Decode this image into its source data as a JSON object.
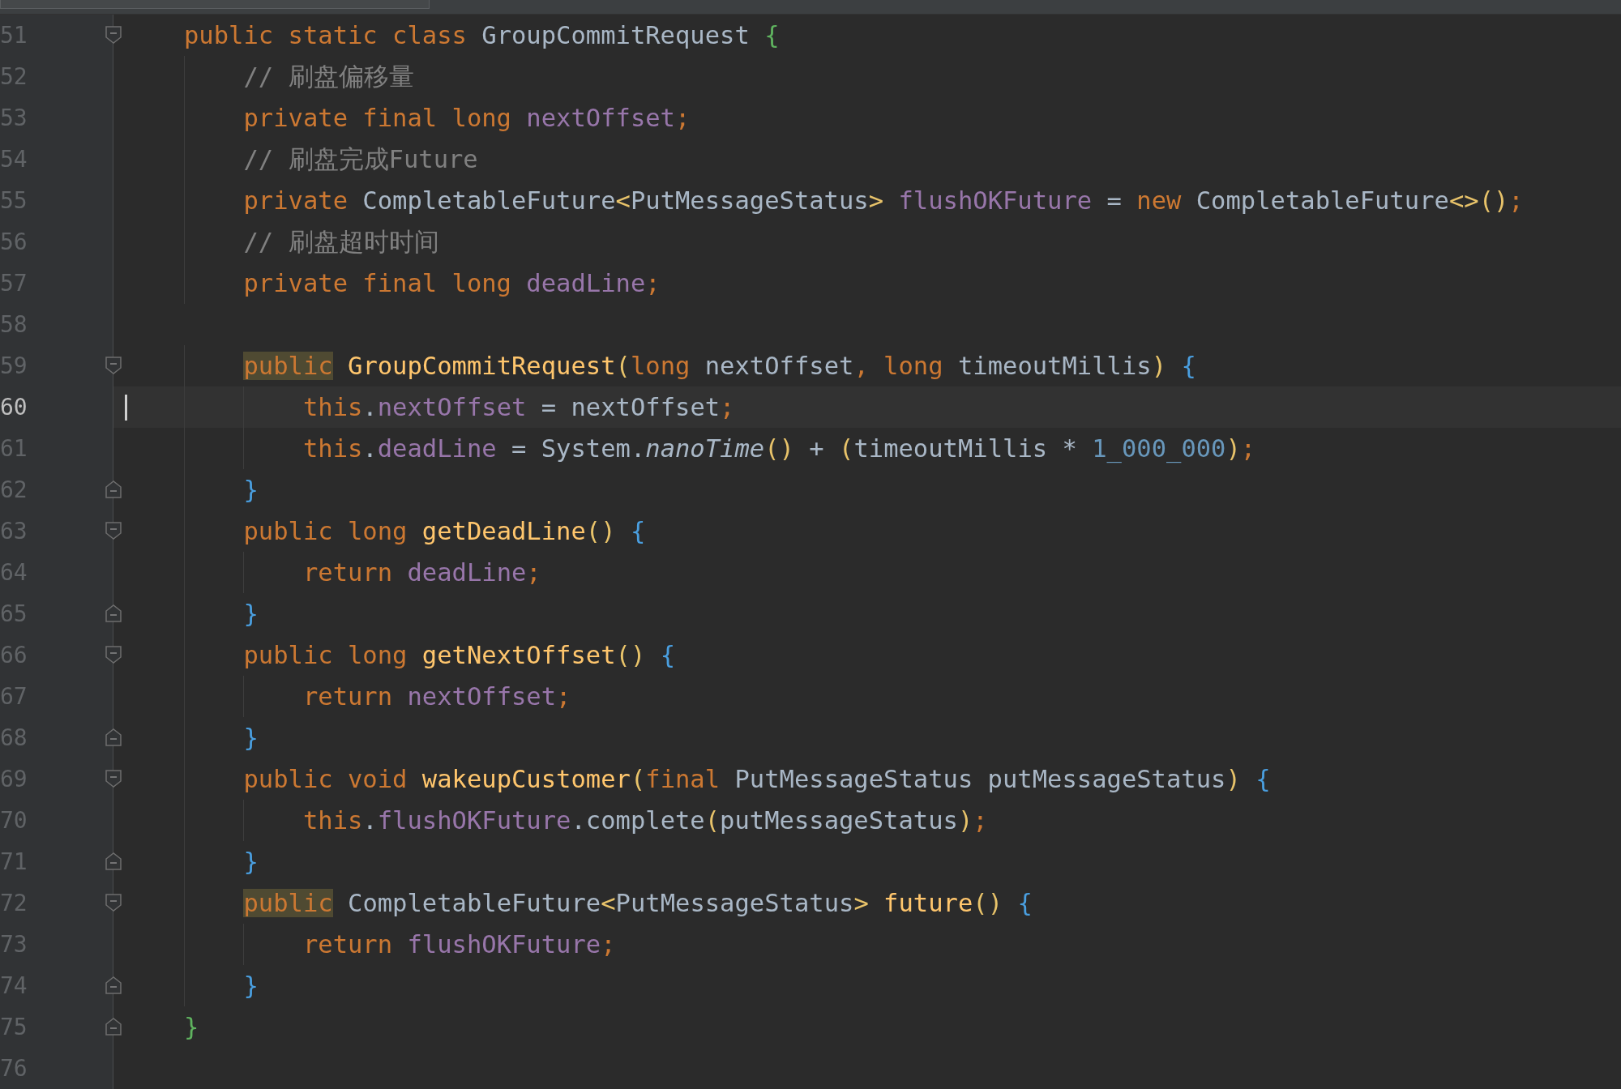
{
  "lines": [
    {
      "number": "51",
      "kind": "block-start",
      "tokens": [
        {
          "kind": "keyword",
          "text": "public static class "
        },
        {
          "kind": "plain",
          "text": "GroupCommitRequest "
        },
        {
          "kind": "brace-outer",
          "text": "{"
        }
      ]
    },
    {
      "number": "52",
      "kind": "code",
      "tokens": [
        {
          "kind": "comment",
          "text": "    // 刷盘偏移量"
        }
      ]
    },
    {
      "number": "53",
      "kind": "code",
      "tokens": [
        {
          "kind": "keyword",
          "text": "    private final long "
        },
        {
          "kind": "field",
          "text": "nextOffset"
        },
        {
          "kind": "keyword",
          "text": ";"
        }
      ]
    },
    {
      "number": "54",
      "kind": "code",
      "tokens": [
        {
          "kind": "comment",
          "text": "    // 刷盘完成Future"
        }
      ]
    },
    {
      "number": "55",
      "kind": "code",
      "tokens": [
        {
          "kind": "keyword",
          "text": "    private "
        },
        {
          "kind": "plain",
          "text": "CompletableFuture"
        },
        {
          "kind": "bracket",
          "text": "<"
        },
        {
          "kind": "plain",
          "text": "PutMessageStatus"
        },
        {
          "kind": "bracket",
          "text": "> "
        },
        {
          "kind": "field",
          "text": "flushOKFuture"
        },
        {
          "kind": "plain",
          "text": " = "
        },
        {
          "kind": "keyword",
          "text": "new "
        },
        {
          "kind": "plain",
          "text": "CompletableFuture"
        },
        {
          "kind": "bracket",
          "text": "<>()"
        },
        {
          "kind": "keyword",
          "text": ";"
        }
      ]
    },
    {
      "number": "56",
      "kind": "code",
      "tokens": [
        {
          "kind": "comment",
          "text": "    // 刷盘超时时间"
        }
      ]
    },
    {
      "number": "57",
      "kind": "code",
      "tokens": [
        {
          "kind": "keyword",
          "text": "    private final long "
        },
        {
          "kind": "field",
          "text": "deadLine"
        },
        {
          "kind": "keyword",
          "text": ";"
        }
      ]
    },
    {
      "number": "58",
      "kind": "code"
    },
    {
      "number": "59",
      "kind": "block-start",
      "tokens": [
        {
          "kind": "keyword-highlighted",
          "text": "    public"
        },
        {
          "kind": "method",
          "text": " GroupCommitRequest"
        },
        {
          "kind": "bracket",
          "text": "("
        },
        {
          "kind": "keyword",
          "text": "long "
        },
        {
          "kind": "plain",
          "text": "nextOffset"
        },
        {
          "kind": "keyword",
          "text": ", long "
        },
        {
          "kind": "plain",
          "text": "timeoutMillis"
        },
        {
          "kind": "bracket",
          "text": ") "
        },
        {
          "kind": "brace-inner",
          "text": "{"
        }
      ]
    },
    {
      "number": "60",
      "kind": "code",
      "current": true,
      "tokens": [
        {
          "kind": "keyword",
          "text": "        this"
        },
        {
          "kind": "plain",
          "text": "."
        },
        {
          "kind": "field",
          "text": "nextOffset"
        },
        {
          "kind": "plain",
          "text": " = nextOffset"
        },
        {
          "kind": "keyword",
          "text": ";"
        }
      ]
    },
    {
      "number": "61",
      "kind": "code",
      "tokens": [
        {
          "kind": "keyword",
          "text": "        this"
        },
        {
          "kind": "plain",
          "text": "."
        },
        {
          "kind": "field",
          "text": "deadLine"
        },
        {
          "kind": "plain",
          "text": " = System."
        },
        {
          "kind": "static-call",
          "text": "nanoTime"
        },
        {
          "kind": "bracket",
          "text": "()"
        },
        {
          "kind": "plain",
          "text": " + "
        },
        {
          "kind": "bracket",
          "text": "("
        },
        {
          "kind": "plain",
          "text": "timeoutMillis * "
        },
        {
          "kind": "number",
          "text": "1_000_000"
        },
        {
          "kind": "bracket",
          "text": ")"
        },
        {
          "kind": "keyword",
          "text": ";"
        }
      ]
    },
    {
      "number": "62",
      "kind": "block-end",
      "tokens": [
        {
          "kind": "brace-inner",
          "text": "    }"
        }
      ]
    },
    {
      "number": "63",
      "kind": "block-start",
      "tokens": [
        {
          "kind": "keyword",
          "text": "    public long "
        },
        {
          "kind": "method",
          "text": "getDeadLine"
        },
        {
          "kind": "bracket",
          "text": "() "
        },
        {
          "kind": "brace-inner",
          "text": "{"
        }
      ]
    },
    {
      "number": "64",
      "kind": "code",
      "tokens": [
        {
          "kind": "keyword",
          "text": "        return "
        },
        {
          "kind": "field",
          "text": "deadLine"
        },
        {
          "kind": "keyword",
          "text": ";"
        }
      ]
    },
    {
      "number": "65",
      "kind": "block-end",
      "tokens": [
        {
          "kind": "brace-inner",
          "text": "    }"
        }
      ]
    },
    {
      "number": "66",
      "kind": "block-start",
      "tokens": [
        {
          "kind": "keyword",
          "text": "    public long "
        },
        {
          "kind": "method",
          "text": "getNextOffset"
        },
        {
          "kind": "bracket",
          "text": "() "
        },
        {
          "kind": "brace-inner",
          "text": "{"
        }
      ]
    },
    {
      "number": "67",
      "kind": "code",
      "tokens": [
        {
          "kind": "keyword",
          "text": "        return "
        },
        {
          "kind": "field",
          "text": "nextOffset"
        },
        {
          "kind": "keyword",
          "text": ";"
        }
      ]
    },
    {
      "number": "68",
      "kind": "block-end",
      "tokens": [
        {
          "kind": "brace-inner",
          "text": "    }"
        }
      ]
    },
    {
      "number": "69",
      "kind": "block-start",
      "tokens": [
        {
          "kind": "keyword",
          "text": "    public void "
        },
        {
          "kind": "method",
          "text": "wakeupCustomer"
        },
        {
          "kind": "bracket",
          "text": "("
        },
        {
          "kind": "keyword",
          "text": "final "
        },
        {
          "kind": "plain",
          "text": "PutMessageStatus putMessageStatus"
        },
        {
          "kind": "bracket",
          "text": ") "
        },
        {
          "kind": "brace-inner",
          "text": "{"
        }
      ]
    },
    {
      "number": "70",
      "kind": "code",
      "tokens": [
        {
          "kind": "keyword",
          "text": "        this"
        },
        {
          "kind": "plain",
          "text": "."
        },
        {
          "kind": "field",
          "text": "flushOKFuture"
        },
        {
          "kind": "plain",
          "text": ".complete"
        },
        {
          "kind": "bracket",
          "text": "("
        },
        {
          "kind": "plain",
          "text": "putMessageStatus"
        },
        {
          "kind": "bracket",
          "text": ")"
        },
        {
          "kind": "keyword",
          "text": ";"
        }
      ]
    },
    {
      "number": "71",
      "kind": "block-end",
      "tokens": [
        {
          "kind": "brace-inner",
          "text": "    }"
        }
      ]
    },
    {
      "number": "72",
      "kind": "block-start",
      "tokens": [
        {
          "kind": "keyword-highlighted",
          "text": "    public"
        },
        {
          "kind": "plain",
          "text": " CompletableFuture"
        },
        {
          "kind": "bracket",
          "text": "<"
        },
        {
          "kind": "plain",
          "text": "PutMessageStatus"
        },
        {
          "kind": "bracket",
          "text": "> "
        },
        {
          "kind": "method",
          "text": "future"
        },
        {
          "kind": "bracket",
          "text": "() "
        },
        {
          "kind": "brace-inner",
          "text": "{"
        }
      ]
    },
    {
      "number": "73",
      "kind": "code",
      "tokens": [
        {
          "kind": "keyword",
          "text": "        return "
        },
        {
          "kind": "field",
          "text": "flushOKFuture"
        },
        {
          "kind": "keyword",
          "text": ";"
        }
      ]
    },
    {
      "number": "74",
      "kind": "block-end",
      "tokens": [
        {
          "kind": "brace-inner",
          "text": "    }"
        }
      ]
    },
    {
      "number": "75",
      "kind": "block-end",
      "tokens": [
        {
          "kind": "brace-outer",
          "text": "}"
        }
      ]
    },
    {
      "number": "76",
      "kind": "code"
    }
  ]
}
